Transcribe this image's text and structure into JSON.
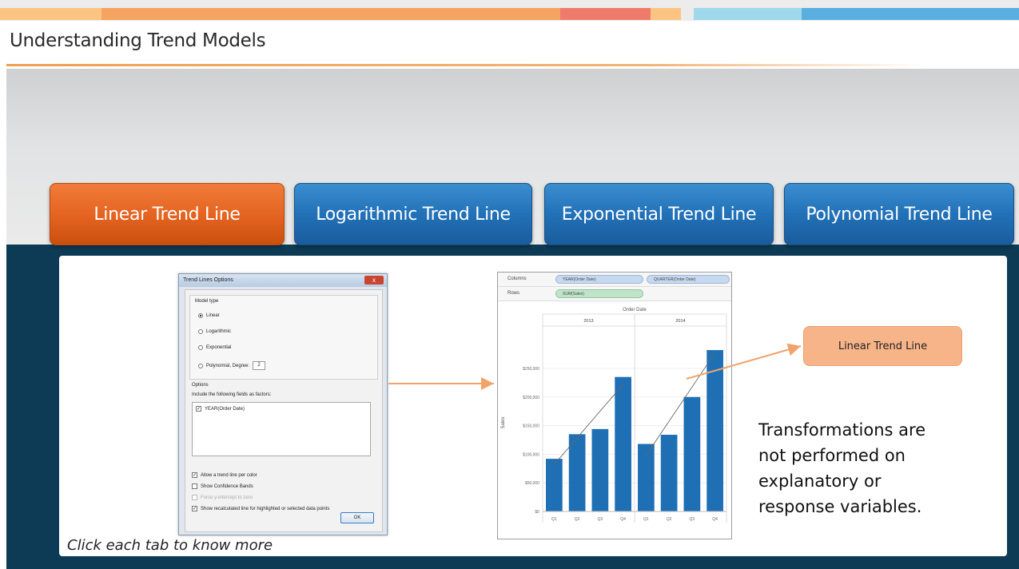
{
  "page": {
    "title": "Understanding Trend Models",
    "hint": "Click each tab to know more"
  },
  "topbar": {
    "colors": [
      "#fbc483",
      "#f4a360",
      "#ef7c6a",
      "#9ed8ea",
      "#5aaee0"
    ]
  },
  "tabs": [
    {
      "label": "Linear Trend Line",
      "active": true
    },
    {
      "label": "Logarithmic Trend Line",
      "active": false
    },
    {
      "label": "Exponential Trend Line",
      "active": false
    },
    {
      "label": "Polynomial Trend Line",
      "active": false
    }
  ],
  "dialog": {
    "title": "Trend Lines Options",
    "close": "x",
    "model_type_label": "Model type",
    "models": [
      "Linear",
      "Logarithmic",
      "Exponential",
      "Polynomial, Degree:"
    ],
    "degree_value": "2",
    "options_label": "Options",
    "factors_label": "Include the following fields as factors:",
    "factor_item": "YEAR(Order Date)",
    "checks": [
      {
        "label": "Allow a trend line per color",
        "checked": true
      },
      {
        "label": "Show Confidence Bands",
        "checked": false
      },
      {
        "label": "Force y-intercept to zero",
        "checked": false,
        "disabled": true
      },
      {
        "label": "Show recalculated line for highlighted or selected data points",
        "checked": true
      }
    ],
    "ok_label": "OK"
  },
  "viz": {
    "columns_label": "Columns",
    "rows_label": "Rows",
    "column_pills": [
      "YEAR(Order Date)",
      "QUARTER(Order Date)"
    ],
    "row_pill": "SUM(Sales)",
    "header": "Order Date",
    "ylabel": "Sales"
  },
  "chart_data": {
    "type": "bar",
    "title": "Order Date",
    "ylabel": "Sales",
    "ylim": [
      0,
      310000
    ],
    "yticks": [
      0,
      50000,
      100000,
      150000,
      200000,
      250000
    ],
    "ytick_labels": [
      "$0",
      "$50,000",
      "$100,000",
      "$150,000",
      "$200,000",
      "$250,000"
    ],
    "groups": [
      {
        "name": "2013",
        "categories": [
          "Q1",
          "Q2",
          "Q3",
          "Q4"
        ],
        "values": [
          92000,
          135000,
          144000,
          235000
        ],
        "trend": [
          82000,
          222000
        ]
      },
      {
        "name": "2014",
        "categories": [
          "Q1",
          "Q2",
          "Q3",
          "Q4"
        ],
        "values": [
          118000,
          134000,
          200000,
          282000
        ],
        "trend": [
          98000,
          277000
        ]
      }
    ],
    "bar_color": "#1f6fb5",
    "trend_color": "#666666"
  },
  "callout": {
    "label": "Linear Trend Line",
    "color": "#f7b488"
  },
  "note": {
    "lines": [
      "Transformations are",
      "not performed on",
      "explanatory or",
      "response variables."
    ]
  }
}
